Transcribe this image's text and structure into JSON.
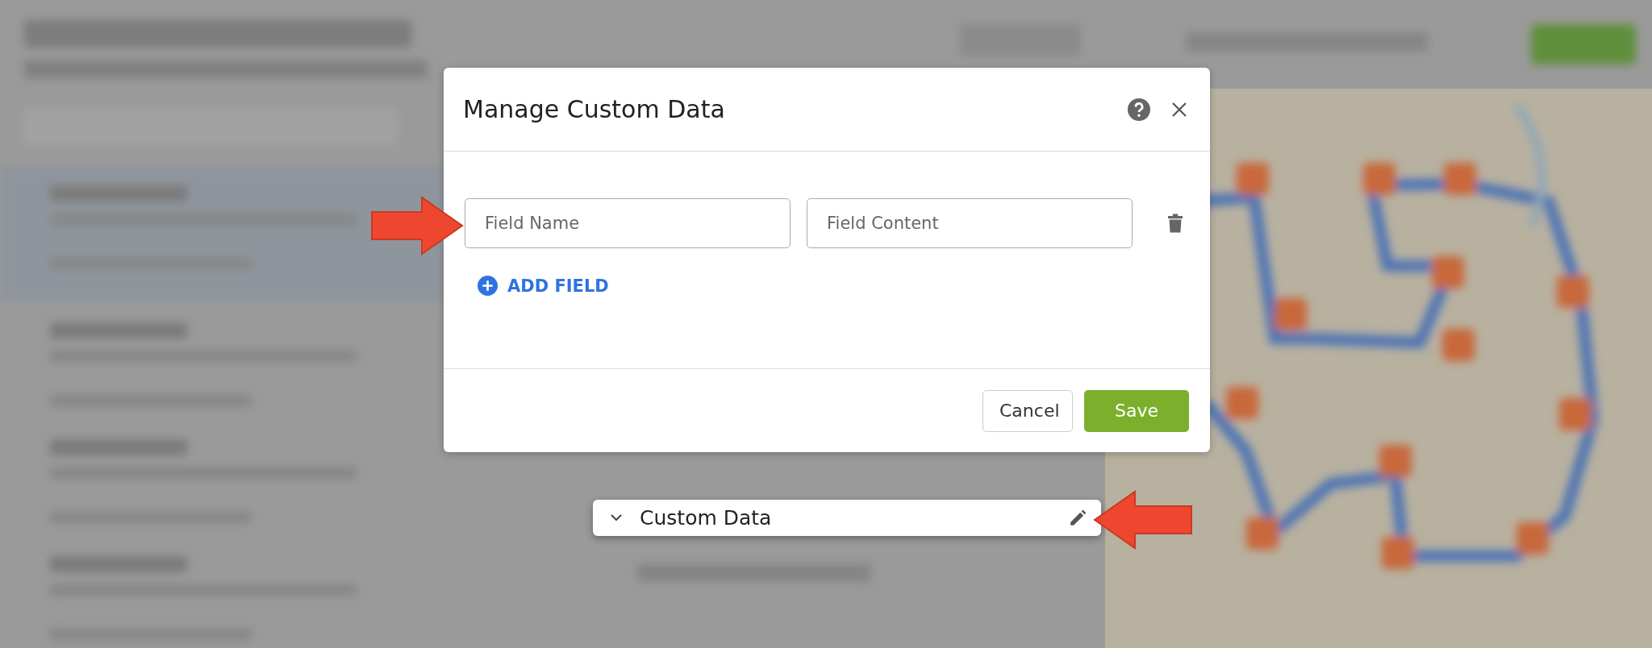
{
  "dialog": {
    "title": "Manage Custom Data",
    "rows": [
      {
        "name_placeholder": "Field Name",
        "content_placeholder": "Field Content"
      }
    ],
    "add_label": "ADD FIELD",
    "buttons": [
      {
        "label": "Cancel",
        "kind": "secondary"
      },
      {
        "label": "Save",
        "kind": "primary"
      }
    ]
  },
  "section": {
    "title": "Custom Data",
    "expanded": true
  }
}
